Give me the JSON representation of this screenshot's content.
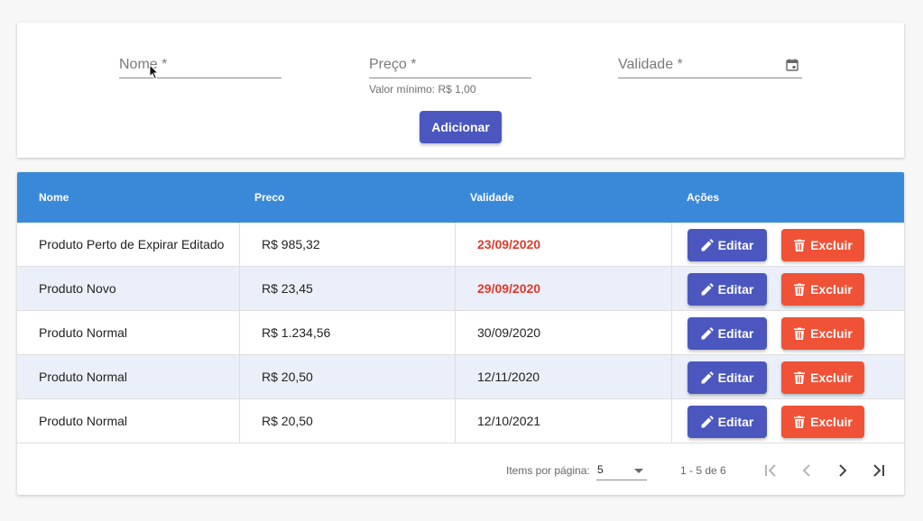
{
  "form": {
    "nome_label": "Nome *",
    "preco_label": "Preço *",
    "preco_hint": "Valor mínimo: R$ 1,00",
    "validade_label": "Validade *",
    "add_label": "Adicionar"
  },
  "table": {
    "headers": [
      "Nome",
      "Preco",
      "Validade",
      "Ações"
    ],
    "rows": [
      {
        "nome": "Produto Perto de Expirar Editado",
        "preco": "R$ 985,32",
        "validade": "23/09/2020",
        "expiring": true
      },
      {
        "nome": "Produto Novo",
        "preco": "R$ 23,45",
        "validade": "29/09/2020",
        "expiring": true
      },
      {
        "nome": "Produto Normal",
        "preco": "R$ 1.234,56",
        "validade": "30/09/2020",
        "expiring": false
      },
      {
        "nome": "Produto Normal",
        "preco": "R$ 20,50",
        "validade": "12/11/2020",
        "expiring": false
      },
      {
        "nome": "Produto Normal",
        "preco": "R$ 20,50",
        "validade": "12/10/2021",
        "expiring": false
      }
    ],
    "edit_label": "Editar",
    "delete_label": "Excluir"
  },
  "paginator": {
    "items_label": "Items por página:",
    "page_size": "5",
    "range_label": "1 - 5 de 6"
  },
  "colors": {
    "header_bg": "#3a89d9",
    "primary": "#4b57be",
    "danger": "#ef5237",
    "expiring_text": "#e0392b",
    "alt_row": "#ebeff9"
  },
  "icons": [
    "calendar-icon",
    "pencil-icon",
    "trash-icon",
    "first-page-icon",
    "previous-page-icon",
    "next-page-icon",
    "last-page-icon"
  ]
}
